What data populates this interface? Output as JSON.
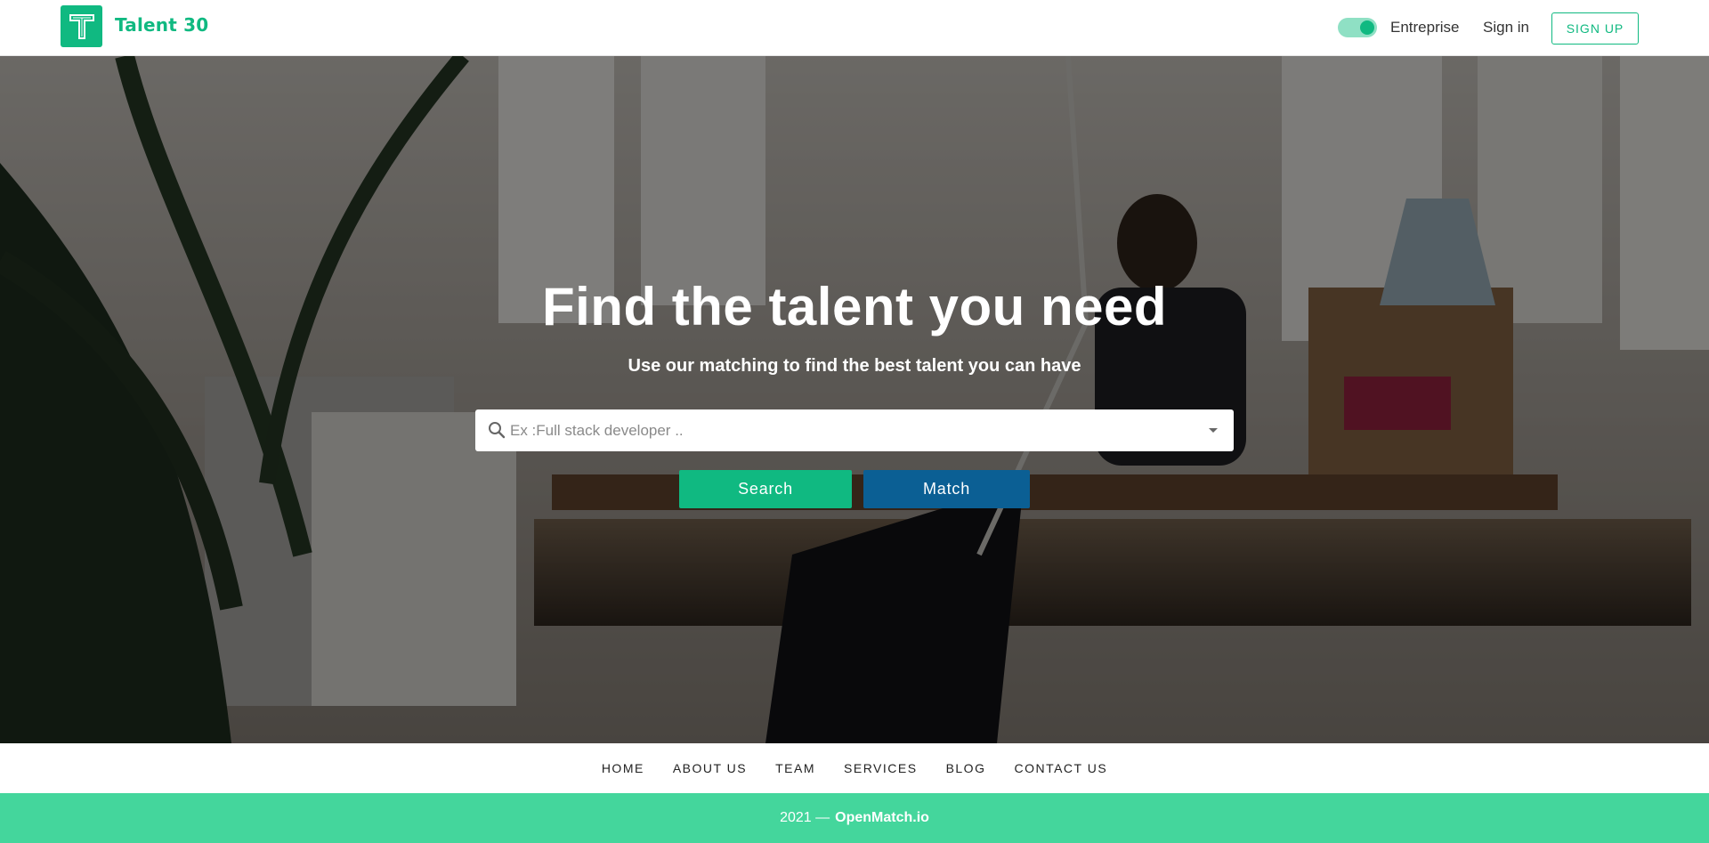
{
  "header": {
    "logo_letter": "T",
    "brand_name": "Talent 30",
    "toggle_on": true,
    "entreprise_label": "Entreprise",
    "signin_label": "Sign in",
    "signup_label": "SIGN UP"
  },
  "hero": {
    "title": "Find the talent you need",
    "subtitle": "Use our matching to find the best talent you can have",
    "search": {
      "placeholder": "Ex :Full stack developer ..",
      "value": ""
    },
    "search_button": "Search",
    "match_button": "Match"
  },
  "footer": {
    "nav": [
      "HOME",
      "ABOUT US",
      "TEAM",
      "SERVICES",
      "BLOG",
      "CONTACT US"
    ],
    "copyright_prefix": "2021 —",
    "copyright_brand": "OpenMatch.io"
  },
  "colors": {
    "brand_green": "#10b981",
    "match_blue": "#0b5f94",
    "footer_green": "#44d69c"
  },
  "icons": {
    "search": "search-icon",
    "dropdown": "chevron-down-icon",
    "logo": "talent-logo-icon"
  }
}
